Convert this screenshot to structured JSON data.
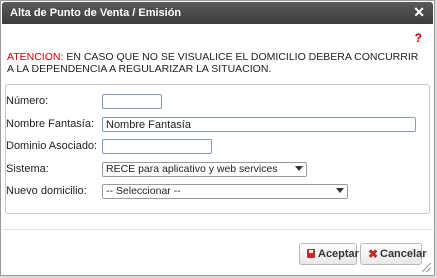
{
  "dialog": {
    "title": "Alta de Punto de Venta / Emisión",
    "close_glyph": "✕",
    "help_glyph": "?"
  },
  "warning": {
    "label": "ATENCION:",
    "text": " EN CASO QUE NO SE VISUALICE EL DOMICILIO DEBERA CONCURRIR A LA DEPENDENCIA A REGULARIZAR LA SITUACION."
  },
  "form": {
    "numero": {
      "label": "Número:",
      "value": ""
    },
    "nombre_fantasia": {
      "label": "Nombre Fantasía:",
      "value": "Nombre Fantasía"
    },
    "dominio": {
      "label": "Dominio Asociado:",
      "value": ""
    },
    "sistema": {
      "label": "Sistema:",
      "value": "RECE para aplicativo y web services"
    },
    "domicilio": {
      "label": "Nuevo domicilio:",
      "value": "-- Seleccionar --"
    }
  },
  "buttons": {
    "accept": "Aceptar",
    "cancel": "Cancelar"
  },
  "colors": {
    "titlebar": "#4a4a4a",
    "warning_label": "#cc0000",
    "field_border": "#7a9cc6",
    "button_icon": "#c62828"
  }
}
